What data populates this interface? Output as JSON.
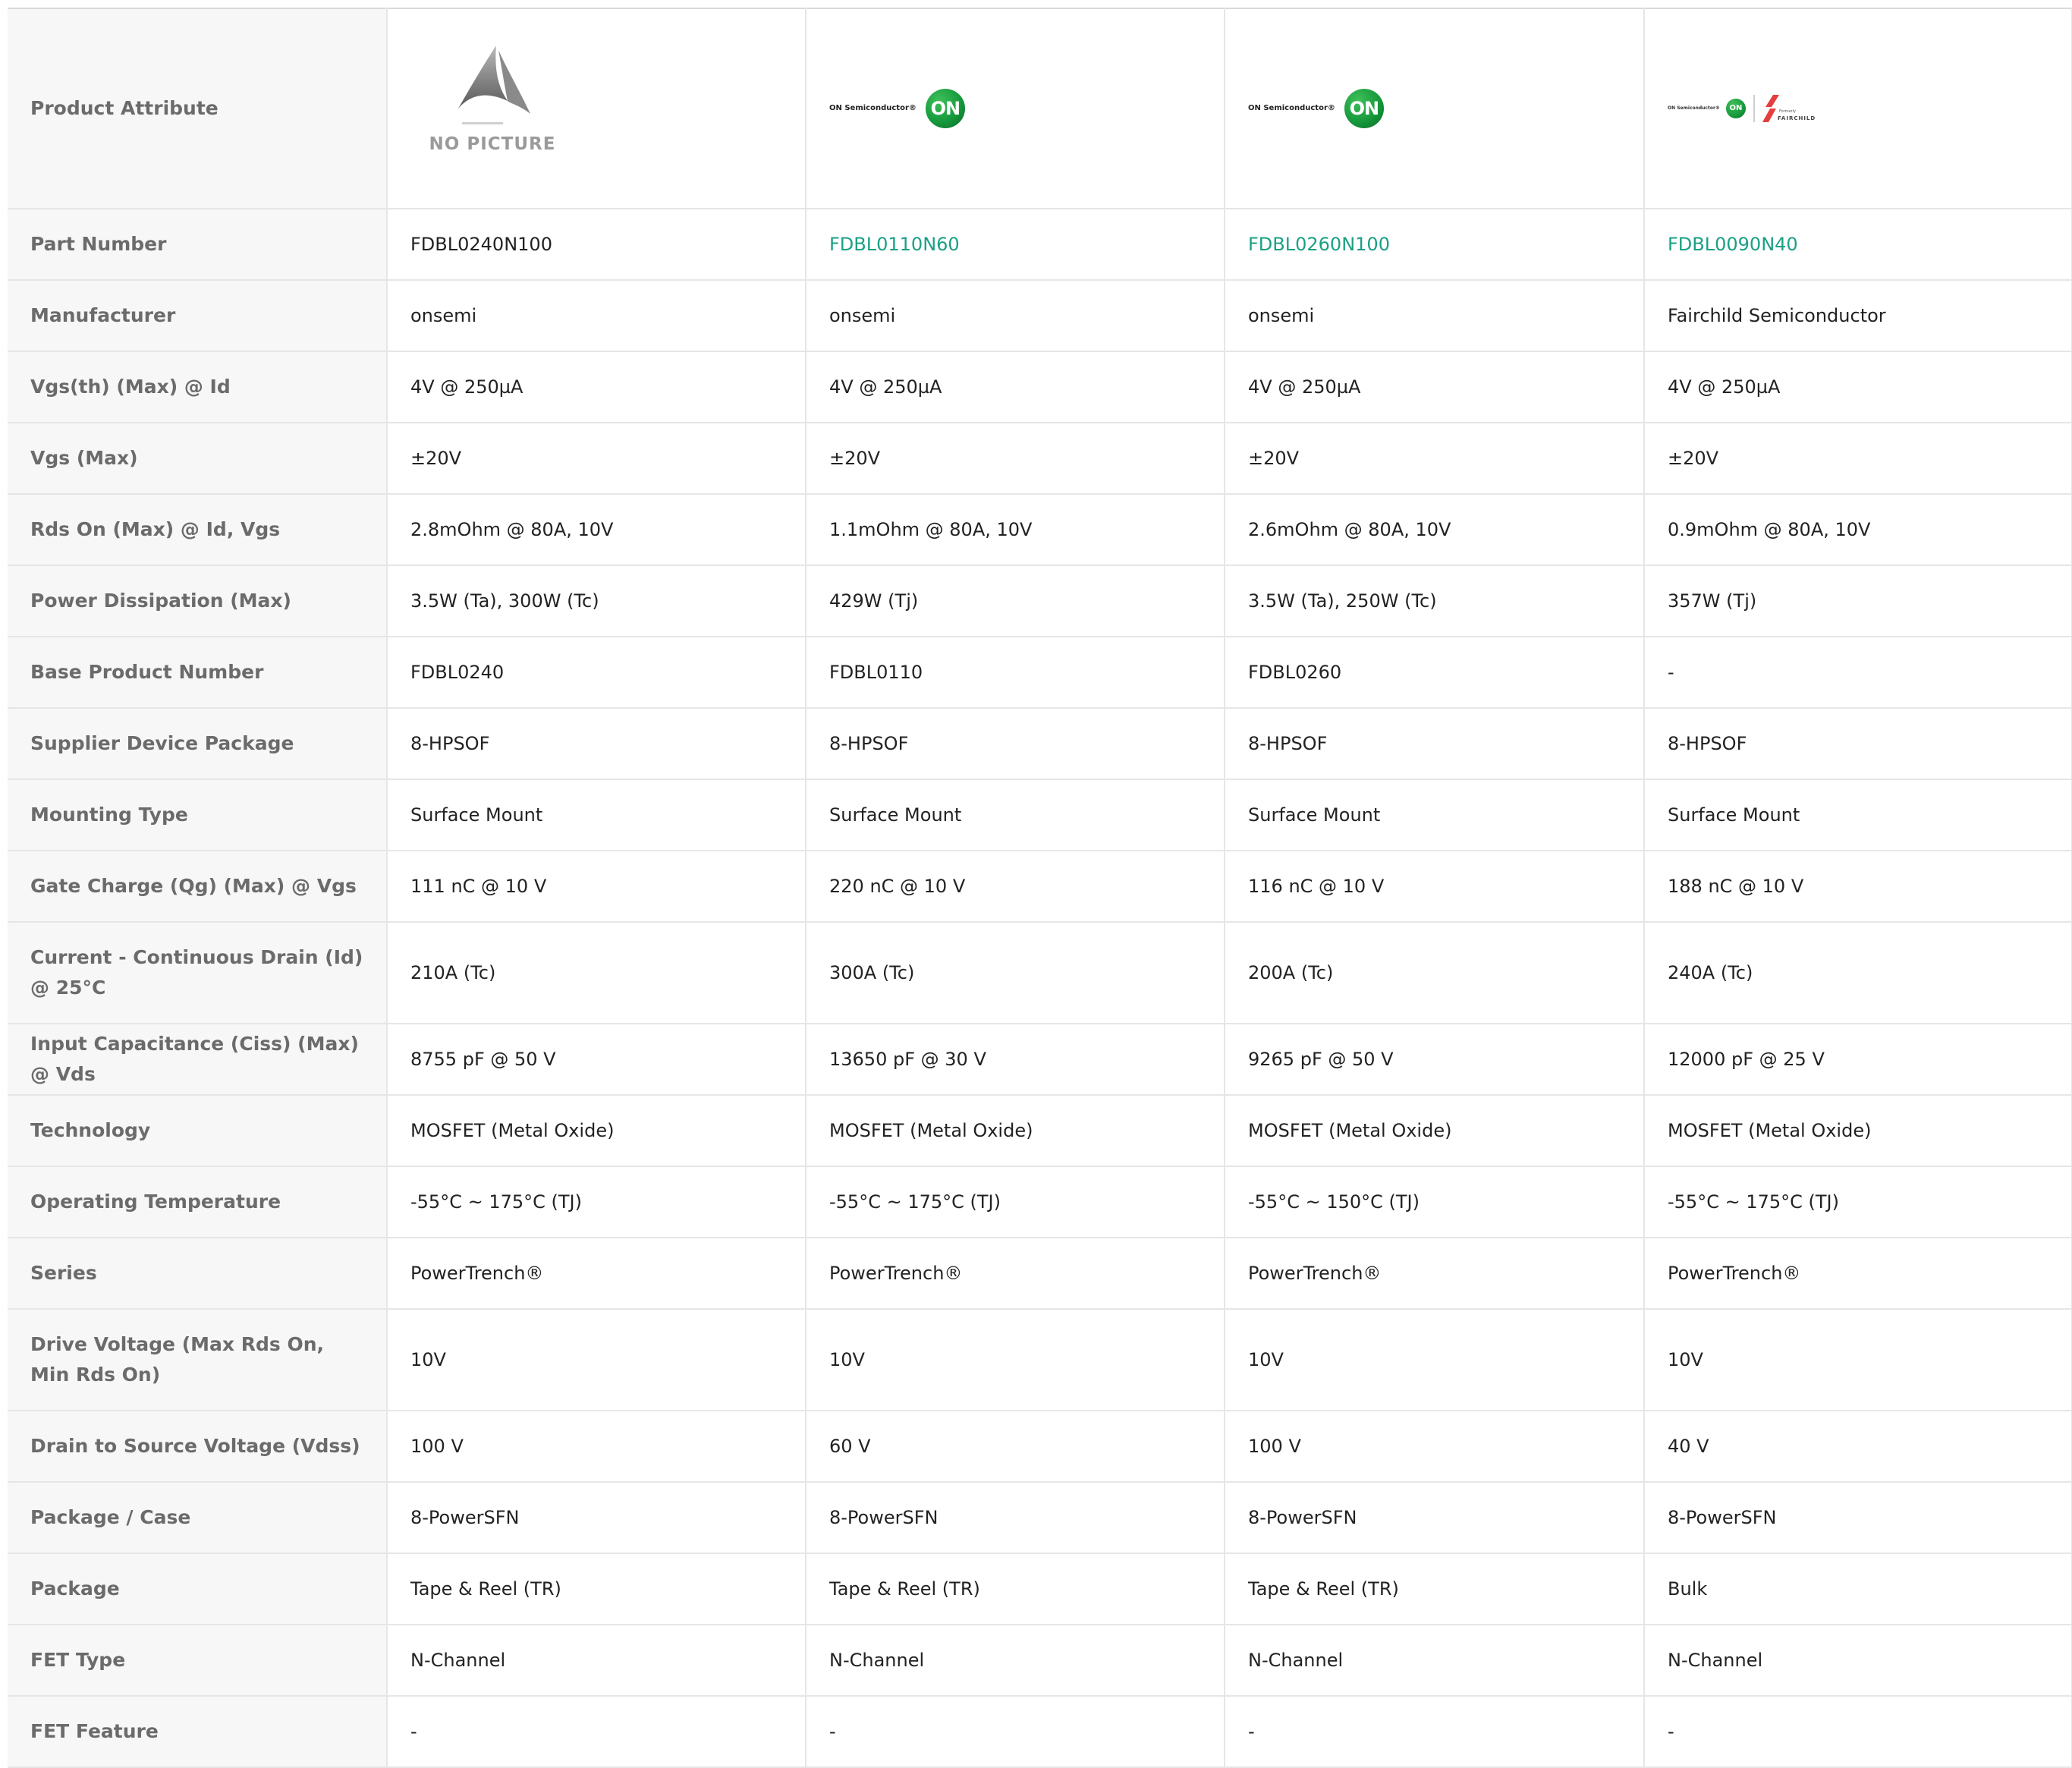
{
  "attribute_header": "Product Attribute",
  "logos": {
    "no_picture_text": "NO PICTURE",
    "on_wordmark": "ON Semiconductor®",
    "on_mark": "ON",
    "fairchild_formerly": "Formerly",
    "fairchild_name": "FAIRCHILD"
  },
  "colors": {
    "link": "#1aa085",
    "header_bg": "#f7f7f7",
    "label_text": "#6b6b6b",
    "on_green": "#169a3c",
    "fairchild_red": "#e53e3e"
  },
  "rows": [
    {
      "label": "Part Number",
      "values": [
        "FDBL0240N100",
        "FDBL0110N60",
        "FDBL0260N100",
        "FDBL0090N40"
      ]
    },
    {
      "label": "Manufacturer",
      "values": [
        "onsemi",
        "onsemi",
        "onsemi",
        "Fairchild Semiconductor"
      ]
    },
    {
      "label": "Vgs(th) (Max) @ Id",
      "values": [
        "4V @ 250µA",
        "4V @ 250µA",
        "4V @ 250µA",
        "4V @ 250µA"
      ]
    },
    {
      "label": "Vgs (Max)",
      "values": [
        "±20V",
        "±20V",
        "±20V",
        "±20V"
      ]
    },
    {
      "label": "Rds On (Max) @ Id, Vgs",
      "values": [
        "2.8mOhm @ 80A, 10V",
        "1.1mOhm @ 80A, 10V",
        "2.6mOhm @ 80A, 10V",
        "0.9mOhm @ 80A, 10V"
      ]
    },
    {
      "label": "Power Dissipation (Max)",
      "values": [
        "3.5W (Ta), 300W (Tc)",
        "429W (Tj)",
        "3.5W (Ta), 250W (Tc)",
        "357W (Tj)"
      ]
    },
    {
      "label": "Base Product Number",
      "values": [
        "FDBL0240",
        "FDBL0110",
        "FDBL0260",
        "-"
      ]
    },
    {
      "label": "Supplier Device Package",
      "values": [
        "8-HPSOF",
        "8-HPSOF",
        "8-HPSOF",
        "8-HPSOF"
      ]
    },
    {
      "label": "Mounting Type",
      "values": [
        "Surface Mount",
        "Surface Mount",
        "Surface Mount",
        "Surface Mount"
      ]
    },
    {
      "label": "Gate Charge (Qg) (Max) @ Vgs",
      "values": [
        "111 nC @ 10 V",
        "220 nC @ 10 V",
        "116 nC @ 10 V",
        "188 nC @ 10 V"
      ]
    },
    {
      "label": "Current - Continuous Drain (Id) @ 25°C",
      "values": [
        "210A (Tc)",
        "300A (Tc)",
        "200A (Tc)",
        "240A (Tc)"
      ]
    },
    {
      "label": "Input Capacitance (Ciss) (Max) @ Vds",
      "values": [
        "8755 pF @ 50 V",
        "13650 pF @ 30 V",
        "9265 pF @ 50 V",
        "12000 pF @ 25 V"
      ]
    },
    {
      "label": "Technology",
      "values": [
        "MOSFET (Metal Oxide)",
        "MOSFET (Metal Oxide)",
        "MOSFET (Metal Oxide)",
        "MOSFET (Metal Oxide)"
      ]
    },
    {
      "label": "Operating Temperature",
      "values": [
        "-55°C ~ 175°C (TJ)",
        "-55°C ~ 175°C (TJ)",
        "-55°C ~ 150°C (TJ)",
        "-55°C ~ 175°C (TJ)"
      ]
    },
    {
      "label": "Series",
      "values": [
        "PowerTrench®",
        "PowerTrench®",
        "PowerTrench®",
        "PowerTrench®"
      ]
    },
    {
      "label": "Drive Voltage (Max Rds On, Min Rds On)",
      "values": [
        "10V",
        "10V",
        "10V",
        "10V"
      ]
    },
    {
      "label": "Drain to Source Voltage (Vdss)",
      "values": [
        "100 V",
        "60 V",
        "100 V",
        "40 V"
      ]
    },
    {
      "label": "Package / Case",
      "values": [
        "8-PowerSFN",
        "8-PowerSFN",
        "8-PowerSFN",
        "8-PowerSFN"
      ]
    },
    {
      "label": "Package",
      "values": [
        "Tape & Reel (TR)",
        "Tape & Reel (TR)",
        "Tape & Reel (TR)",
        "Bulk"
      ]
    },
    {
      "label": "FET Type",
      "values": [
        "N-Channel",
        "N-Channel",
        "N-Channel",
        "N-Channel"
      ]
    },
    {
      "label": "FET Feature",
      "values": [
        "-",
        "-",
        "-",
        "-"
      ]
    }
  ]
}
